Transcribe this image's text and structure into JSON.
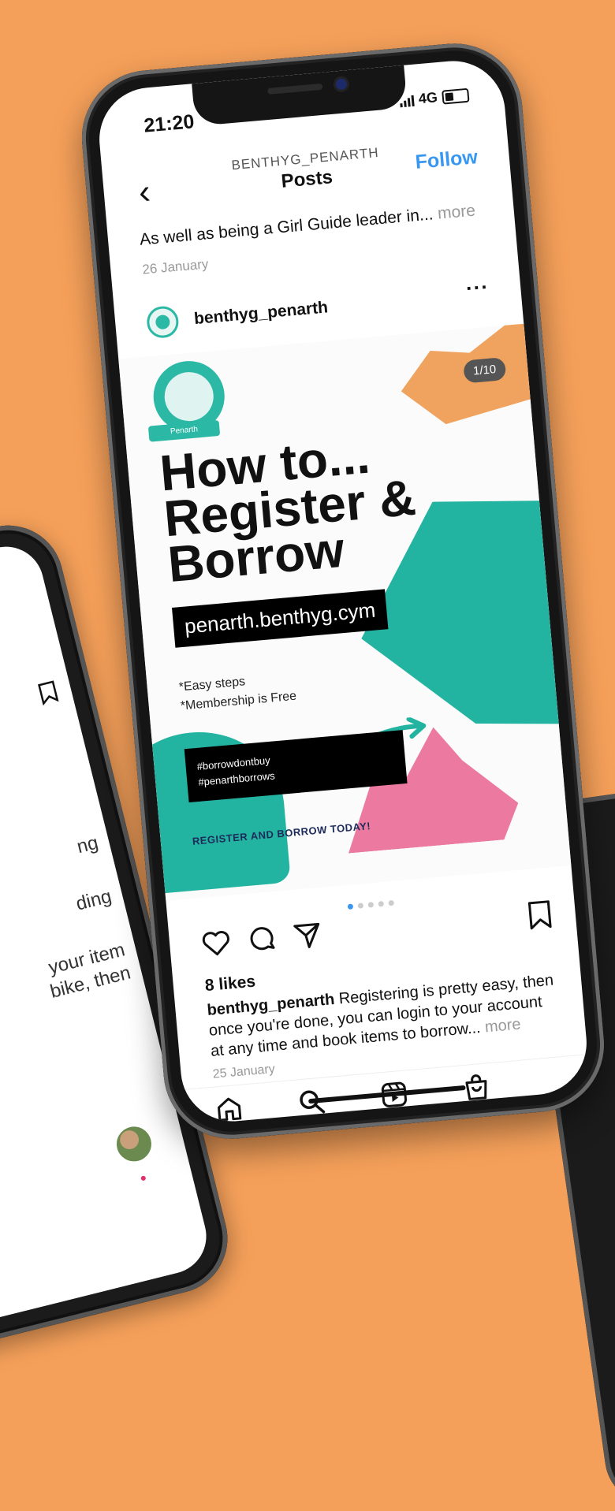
{
  "status_bar": {
    "time": "21:20",
    "network": "4G"
  },
  "header": {
    "account": "BENTHYG_PENARTH",
    "title": "Posts",
    "follow_label": "Follow"
  },
  "previous_post": {
    "caption": "As well as being a Girl Guide leader in...",
    "more": "more",
    "date": "26 January"
  },
  "post": {
    "username": "benthyg_penarth",
    "counter": "1/10",
    "image": {
      "logo_text": "Penarth",
      "headline_1": "How to...",
      "headline_2": "Register &",
      "headline_3": "Borrow",
      "url": "penarth.benthyg.cym",
      "bullet_1": "*Easy steps",
      "bullet_2": "*Membership is Free",
      "hashtag_1": "#borrowdontbuy",
      "hashtag_2": "#penarthborrows",
      "cta": "REGISTER AND BORROW TODAY!"
    },
    "likes": "8 likes",
    "caption_user": "benthyg_penarth",
    "caption_text": "Registering is pretty easy, then once you're done, you can login to your account at any time and book items to borrow...",
    "caption_more": "more",
    "date": "25 January"
  },
  "left_phone": {
    "snippet_1": "ng",
    "snippet_2": "ding",
    "snippet_3": "your item",
    "snippet_4": "bike, then"
  },
  "colors": {
    "background": "#F5A05A",
    "teal": "#23B3A1",
    "pink": "#EC7AA0",
    "orange": "#F0A35E",
    "link_blue": "#3897F0"
  }
}
